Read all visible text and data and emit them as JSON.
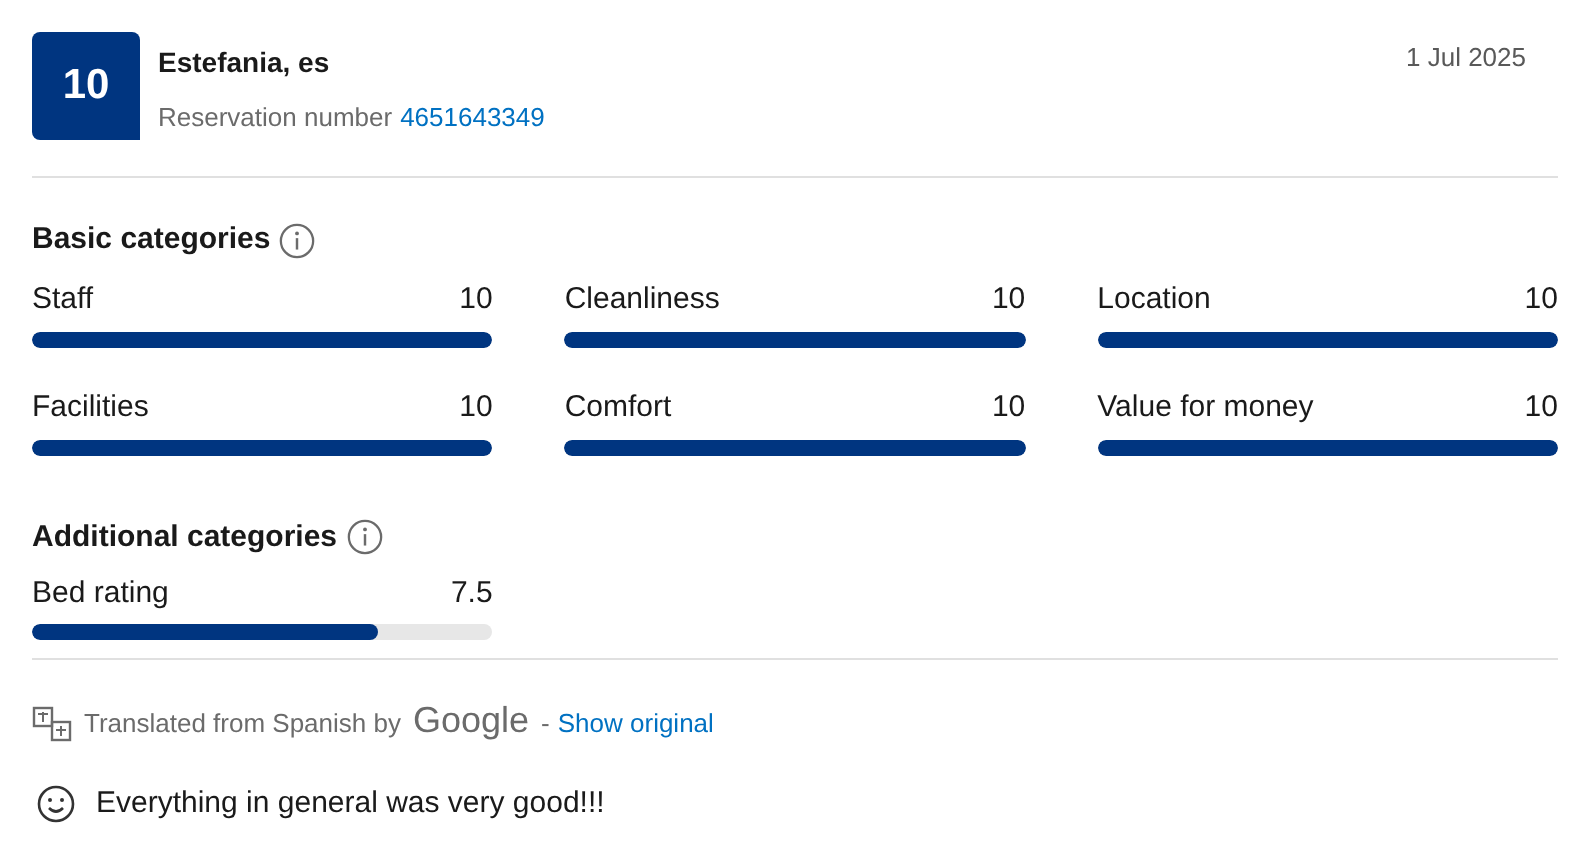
{
  "review": {
    "score": "10",
    "name": "Estefania, es",
    "reservation_label": "Reservation number",
    "reservation_number": "4651643349",
    "date": "1 Jul 2025"
  },
  "basic_categories": {
    "title": "Basic categories",
    "items": [
      {
        "label": "Staff",
        "score": "10",
        "level": 1
      },
      {
        "label": "Cleanliness",
        "score": "10",
        "level": 1
      },
      {
        "label": "Location",
        "score": "10",
        "level": 1
      },
      {
        "label": "Facilities",
        "score": "10",
        "level": 1
      },
      {
        "label": "Comfort",
        "score": "10",
        "level": 1
      },
      {
        "label": "Value for money",
        "score": "10",
        "level": 1
      }
    ]
  },
  "additional_categories": {
    "title": "Additional categories",
    "items": [
      {
        "label": "Bed rating",
        "score": "7.5",
        "level": 0.75
      }
    ]
  },
  "translation": {
    "prefix": "Translated from Spanish by",
    "provider": "Google",
    "separator": "-",
    "link": "Show original"
  },
  "comment": "Everything in general was very good!!!"
}
